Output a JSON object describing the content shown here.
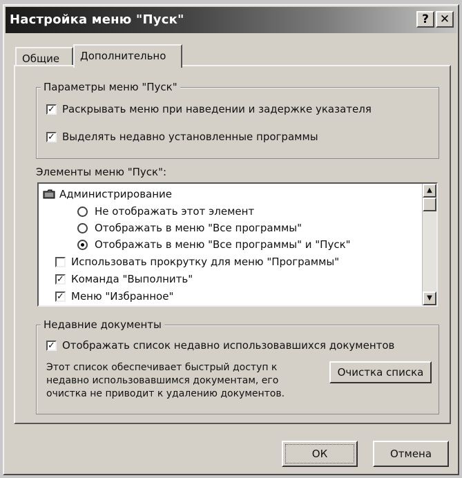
{
  "window": {
    "title": "Настройка меню \"Пуск\"",
    "help_label": "?",
    "close_label": "✕"
  },
  "tabs": [
    {
      "label": "Общие",
      "active": false
    },
    {
      "label": "Дополнительно",
      "active": true
    }
  ],
  "start_params": {
    "legend": "Параметры меню \"Пуск\"",
    "options": [
      {
        "label": "Раскрывать меню при наведении и задержке указателя",
        "checked": true
      },
      {
        "label": "Выделять недавно установленные программы",
        "checked": true
      }
    ]
  },
  "items": {
    "label": "Элементы меню \"Пуск\":",
    "folder_label": "Администрирование",
    "radios": [
      {
        "label": "Не отображать этот элемент",
        "selected": false
      },
      {
        "label": "Отображать в меню \"Все программы\"",
        "selected": false
      },
      {
        "label": "Отображать в меню \"Все программы\" и \"Пуск\"",
        "selected": true
      }
    ],
    "checks": [
      {
        "label": "Использовать прокрутку для меню \"Программы\"",
        "checked": false
      },
      {
        "label": "Команда \"Выполнить\"",
        "checked": true
      },
      {
        "label": "Меню \"Избранное\"",
        "checked": true
      }
    ]
  },
  "docs": {
    "legend": "Недавние документы",
    "option_label": "Отображать список недавно использовавшихся документов",
    "option_checked": true,
    "description": "Этот список обеспечивает быстрый доступ к недавно использовавшимся документам, его очистка не приводит к удалению документов.",
    "clear_button": "Очистка списка"
  },
  "footer": {
    "ok_label": "ОК",
    "cancel_label": "Отмена"
  },
  "check_mark": "✓",
  "icons": [
    "folder-icon",
    "help-icon",
    "close-icon",
    "scroll-up-icon",
    "scroll-down-icon"
  ]
}
